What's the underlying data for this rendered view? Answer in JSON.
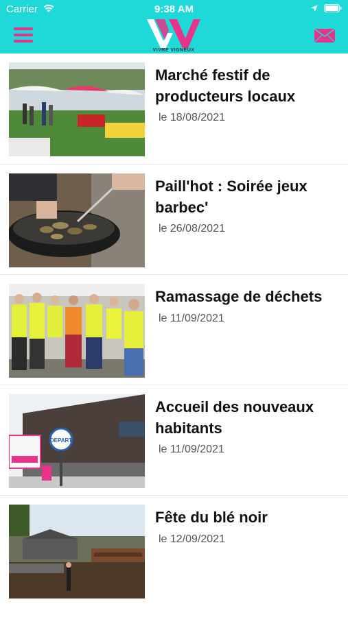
{
  "status_bar": {
    "carrier": "Carrier",
    "time": "9:38 AM"
  },
  "header": {
    "logo_text": "VIVRE VIGNEUX",
    "colors": {
      "background": "#1fd9d9",
      "accent": "#e8338a"
    }
  },
  "articles": [
    {
      "title": "Marché festif de producteurs locaux",
      "date": "le 18/08/2021"
    },
    {
      "title": "Paill'hot : Soirée jeux barbec'",
      "date": "le 26/08/2021"
    },
    {
      "title": "Ramassage de déchets",
      "date": "le 11/09/2021"
    },
    {
      "title": "Accueil des nouveaux habitants",
      "date": "le 11/09/2021"
    },
    {
      "title": "Fête du blé noir",
      "date": "le 12/09/2021"
    }
  ],
  "thumbnail_signs": {
    "depart": "DEPART"
  }
}
